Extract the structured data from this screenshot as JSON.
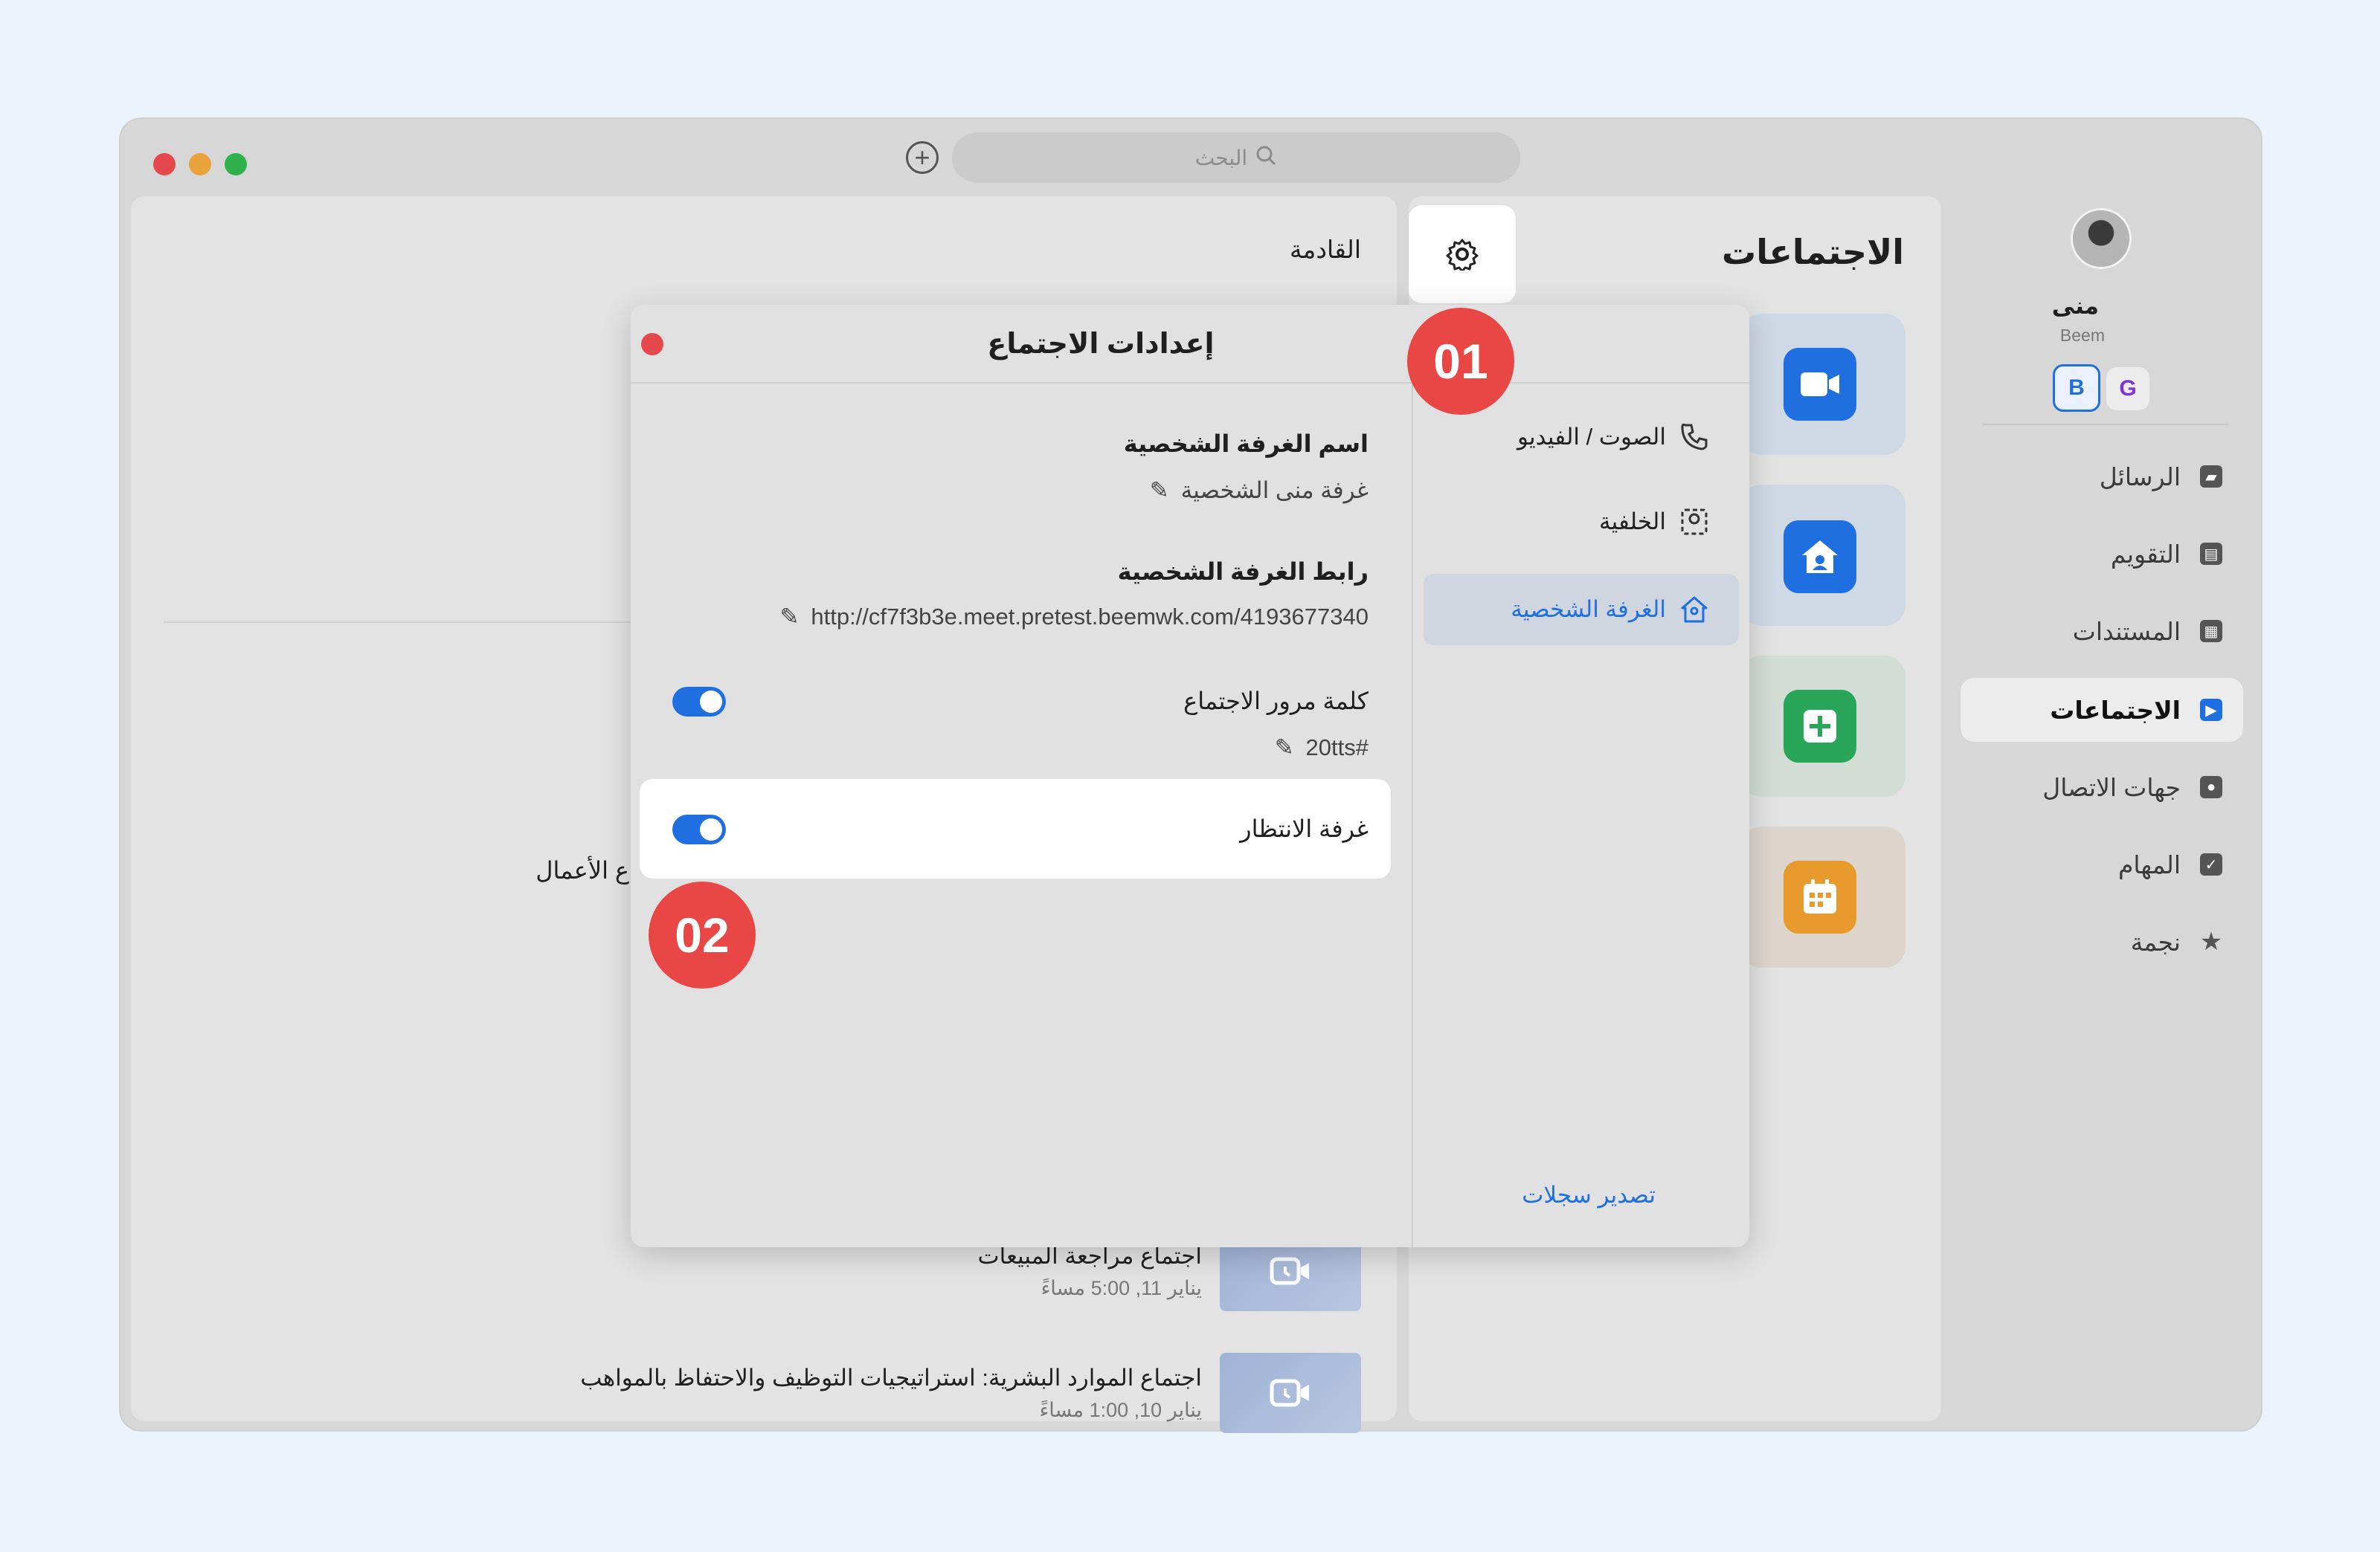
{
  "search": {
    "placeholder": "البحث"
  },
  "profile": {
    "name": "منى",
    "org": "Beem"
  },
  "sidebar": {
    "items": [
      {
        "label": "الرسائل",
        "icon": "chat-icon"
      },
      {
        "label": "التقويم",
        "icon": "calendar-icon"
      },
      {
        "label": "المستندات",
        "icon": "document-icon"
      },
      {
        "label": "الاجتماعات",
        "icon": "video-icon",
        "active": true
      },
      {
        "label": "جهات الاتصال",
        "icon": "contacts-icon"
      },
      {
        "label": "المهام",
        "icon": "checkbox-icon"
      },
      {
        "label": "نجمة",
        "icon": "star-icon"
      }
    ]
  },
  "meetings_panel": {
    "title": "الاجتماعات"
  },
  "upcoming": {
    "heading": "القادمة",
    "partial_text": "ع الأعمال",
    "meetings": [
      {
        "title": "اجتماع مراجعة المبيعات",
        "time": "يناير 11, 5:00 مساءً"
      },
      {
        "title": "اجتماع الموارد البشرية: استراتيجيات التوظيف والاحتفاظ بالمواهب",
        "time": "يناير 10, 1:00 مساءً"
      }
    ]
  },
  "modal": {
    "title": "إعدادات الاجتماع",
    "menu": [
      {
        "label": "الصوت / الفيديو",
        "icon": "phone-video-icon"
      },
      {
        "label": "الخلفية",
        "icon": "background-icon"
      },
      {
        "label": "الغرفة الشخصية",
        "icon": "home-icon",
        "active": true
      }
    ],
    "export_logs": "تصدير سجلات",
    "room_name_label": "اسم الغرفة الشخصية",
    "room_name_value": "غرفة منى الشخصية",
    "room_link_label": "رابط الغرفة الشخصية",
    "room_link_value": "http://cf7f3b3e.meet.pretest.beemwk.com/4193677340",
    "password_label": "كلمة مرور الاجتماع",
    "password_value": "20tts#",
    "password_enabled": true,
    "waiting_room_label": "غرفة الانتظار",
    "waiting_room_enabled": true
  },
  "badges": {
    "first": "01",
    "second": "02"
  },
  "colors": {
    "accent": "#1f6fe0",
    "badge": "#e94646",
    "tile_blue": "#1f6fe0",
    "tile_green": "#2aa65a",
    "tile_orange": "#e89a2c"
  }
}
